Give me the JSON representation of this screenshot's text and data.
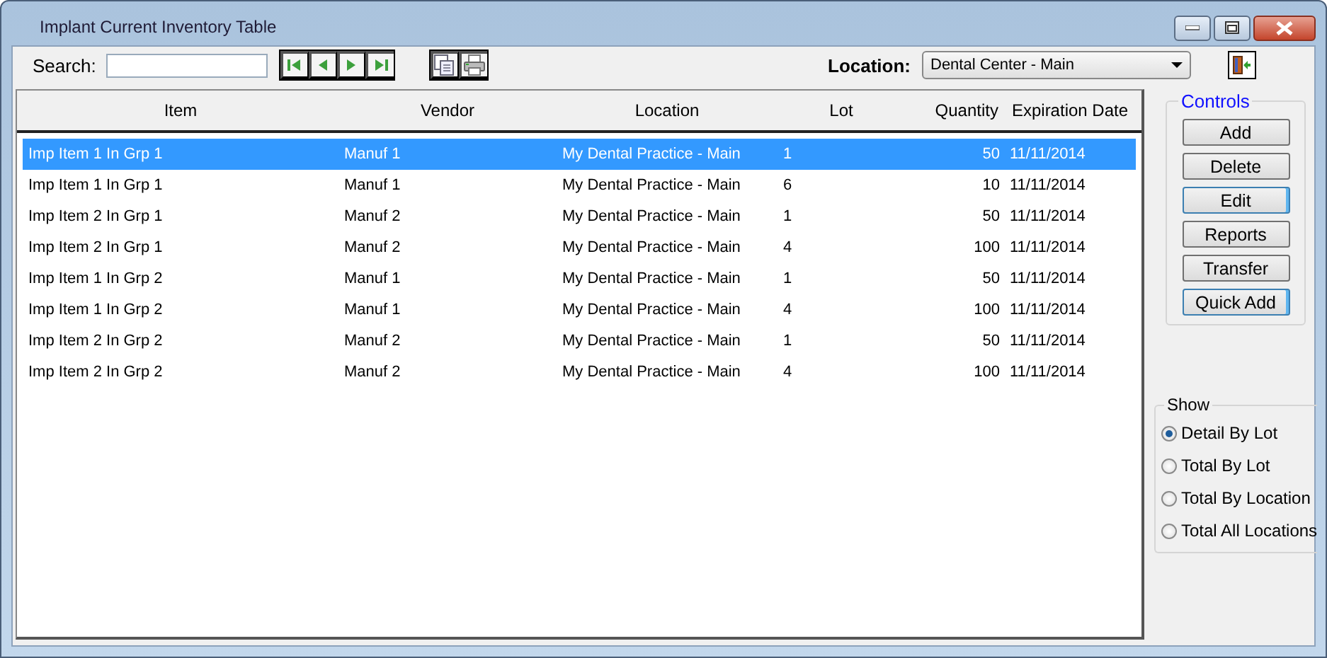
{
  "window": {
    "title": "Implant Current Inventory Table"
  },
  "toolbar": {
    "search": {
      "label": "Search:"
    },
    "location": {
      "label": "Location:",
      "value": "Dental Center - Main"
    }
  },
  "table": {
    "columns": [
      "Item",
      "Vendor",
      "Location",
      "Lot",
      "Quantity",
      "Expiration Date"
    ],
    "rows": [
      {
        "selected": true,
        "cells": [
          "Imp Item 1 In Grp 1",
          "Manuf 1",
          "My Dental Practice - Main",
          "1",
          "50",
          "11/11/2014"
        ]
      },
      {
        "selected": false,
        "cells": [
          "Imp Item 1 In Grp 1",
          "Manuf 1",
          "My Dental Practice - Main",
          "6",
          "10",
          "11/11/2014"
        ]
      },
      {
        "selected": false,
        "cells": [
          "Imp Item 2 In Grp 1",
          "Manuf 2",
          "My Dental Practice - Main",
          "1",
          "50",
          "11/11/2014"
        ]
      },
      {
        "selected": false,
        "cells": [
          "Imp Item 2 In Grp 1",
          "Manuf 2",
          "My Dental Practice - Main",
          "4",
          "100",
          "11/11/2014"
        ]
      },
      {
        "selected": false,
        "cells": [
          "Imp Item 1 In Grp 2",
          "Manuf 1",
          "My Dental Practice - Main",
          "1",
          "50",
          "11/11/2014"
        ]
      },
      {
        "selected": false,
        "cells": [
          "Imp Item 1 In Grp 2",
          "Manuf 1",
          "My Dental Practice - Main",
          "4",
          "100",
          "11/11/2014"
        ]
      },
      {
        "selected": false,
        "cells": [
          "Imp Item 2 In Grp 2",
          "Manuf 2",
          "My Dental Practice - Main",
          "1",
          "50",
          "11/11/2014"
        ]
      },
      {
        "selected": false,
        "cells": [
          "Imp Item 2 In Grp 2",
          "Manuf 2",
          "My Dental Practice - Main",
          "4",
          "100",
          "11/11/2014"
        ]
      }
    ]
  },
  "controls": {
    "title": "Controls",
    "buttons": [
      {
        "label": "Add",
        "focused": false
      },
      {
        "label": "Delete",
        "focused": false
      },
      {
        "label": "Edit",
        "focused": true
      },
      {
        "label": "Reports",
        "focused": false
      },
      {
        "label": "Transfer",
        "focused": false
      },
      {
        "label": "Quick Add",
        "focused": true
      }
    ]
  },
  "show": {
    "title": "Show",
    "options": [
      {
        "label": "Detail By Lot",
        "selected": true
      },
      {
        "label": "Total By Lot",
        "selected": false
      },
      {
        "label": "Total By Location",
        "selected": false
      },
      {
        "label": "Total All Locations",
        "selected": false
      }
    ]
  }
}
